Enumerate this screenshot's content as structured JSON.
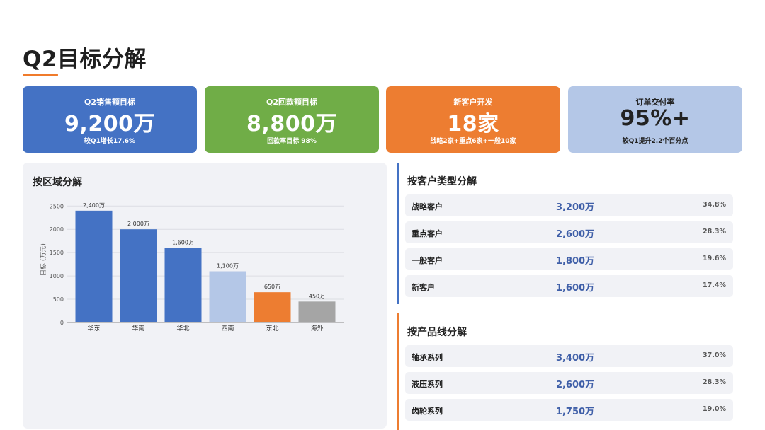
{
  "page": {
    "title": "Q2目标分解"
  },
  "kpis": [
    {
      "label": "Q2销售额目标",
      "value": "9,200万",
      "sub": "较Q1增长17.6%",
      "color": "#4472c4"
    },
    {
      "label": "Q2回款额目标",
      "value": "8,800万",
      "sub": "回款率目标 98%",
      "color": "#70ad47"
    },
    {
      "label": "新客户开发",
      "value": "18家",
      "sub": "战略2家+重点6家+一般10家",
      "color": "#ed7d31"
    },
    {
      "label": "订单交付率",
      "value": "95%+",
      "sub": "较Q1提升2.2个百分点",
      "color": "#b4c7e7"
    }
  ],
  "region": {
    "title": "按区域分解"
  },
  "chart_data": {
    "type": "bar",
    "title": "",
    "categories": [
      "华东",
      "华南",
      "华北",
      "西南",
      "东北",
      "海外"
    ],
    "values": [
      2400,
      2000,
      1600,
      1100,
      650,
      450
    ],
    "data_labels": [
      "2,400万",
      "2,000万",
      "1,600万",
      "1,100万",
      "650万",
      "450万"
    ],
    "bar_colors": [
      "#4472c4",
      "#4472c4",
      "#4472c4",
      "#b4c7e7",
      "#ed7d31",
      "#a5a5a5"
    ],
    "xlabel": "",
    "ylabel": "目标 (万元)",
    "ylim": [
      0,
      2600
    ],
    "yticks": [
      0,
      500,
      1000,
      1500,
      2000,
      2500
    ],
    "grid": true
  },
  "customer_types": {
    "title": "按客户类型分解",
    "rows": [
      {
        "name": "战略客户",
        "value": "3,200万",
        "pct": "34.8%"
      },
      {
        "name": "重点客户",
        "value": "2,600万",
        "pct": "28.3%"
      },
      {
        "name": "一般客户",
        "value": "1,800万",
        "pct": "19.6%"
      },
      {
        "name": "新客户",
        "value": "1,600万",
        "pct": "17.4%"
      }
    ]
  },
  "product_lines": {
    "title": "按产品线分解",
    "rows": [
      {
        "name": "轴承系列",
        "value": "3,400万",
        "pct": "37.0%"
      },
      {
        "name": "液压系列",
        "value": "2,600万",
        "pct": "28.3%"
      },
      {
        "name": "齿轮系列",
        "value": "1,750万",
        "pct": "19.0%"
      }
    ]
  },
  "colors": {
    "accent": "#f07b2b",
    "blue": "#4472c4",
    "green": "#70ad47",
    "orange": "#ed7d31",
    "light_blue": "#b4c7e7",
    "value_text": "#3f5fa8"
  }
}
